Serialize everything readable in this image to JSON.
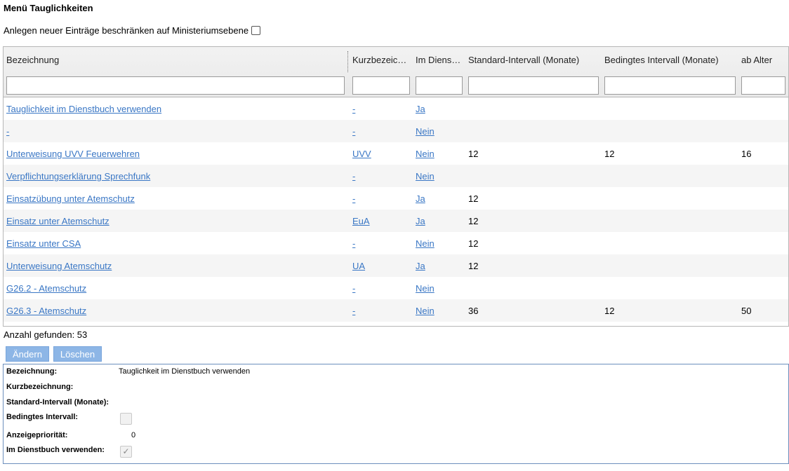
{
  "page": {
    "title": "Menü Tauglichkeiten",
    "restrict_label": "Anlegen neuer Einträge beschränken auf Ministeriumsebene"
  },
  "grid": {
    "columns": [
      "Bezeichnung",
      "Kurzbezeic…",
      "Im Dienst…",
      "Standard-Intervall (Monate)",
      "Bedingtes Intervall (Monate)",
      "ab Alter"
    ],
    "rows": [
      {
        "bez": "Tauglichkeit im Dienstbuch verwenden",
        "kurz": "-",
        "dienst": "Ja",
        "std": "",
        "bed": "",
        "alter": ""
      },
      {
        "bez": "-",
        "kurz": "-",
        "dienst": "Nein",
        "std": "",
        "bed": "",
        "alter": ""
      },
      {
        "bez": "Unterweisung UVV Feuerwehren",
        "kurz": "UVV",
        "dienst": "Nein",
        "std": "12",
        "bed": "12",
        "alter": "16"
      },
      {
        "bez": "Verpflichtungserklärung Sprechfunk",
        "kurz": "-",
        "dienst": "Nein",
        "std": "",
        "bed": "",
        "alter": ""
      },
      {
        "bez": "Einsatzübung unter Atemschutz",
        "kurz": "-",
        "dienst": "Ja",
        "std": "12",
        "bed": "",
        "alter": ""
      },
      {
        "bez": "Einsatz unter Atemschutz",
        "kurz": "EuA",
        "dienst": "Ja",
        "std": "12",
        "bed": "",
        "alter": ""
      },
      {
        "bez": "Einsatz unter CSA",
        "kurz": "-",
        "dienst": "Nein",
        "std": "12",
        "bed": "",
        "alter": ""
      },
      {
        "bez": "Unterweisung Atemschutz",
        "kurz": "UA",
        "dienst": "Ja",
        "std": "12",
        "bed": "",
        "alter": ""
      },
      {
        "bez": "G26.2 - Atemschutz",
        "kurz": "-",
        "dienst": "Nein",
        "std": "",
        "bed": "",
        "alter": ""
      },
      {
        "bez": "G26.3 - Atemschutz",
        "kurz": "-",
        "dienst": "Nein",
        "std": "36",
        "bed": "12",
        "alter": "50"
      }
    ]
  },
  "count_label": "Anzahl gefunden: 53",
  "buttons": {
    "edit": "Ändern",
    "delete": "Löschen"
  },
  "detail": {
    "bezeichnung_label": "Bezeichnung:",
    "bezeichnung_value": "Tauglichkeit im Dienstbuch verwenden",
    "kurz_label": "Kurzbezeichnung:",
    "std_label": "Standard-Intervall (Monate):",
    "bed_label": "Bedingtes Intervall:",
    "prio_label": "Anzeigepriorität:",
    "prio_value": "0",
    "dienst_label": "Im Dienstbuch verwenden:",
    "bed_checked": false,
    "dienst_checked": true
  }
}
